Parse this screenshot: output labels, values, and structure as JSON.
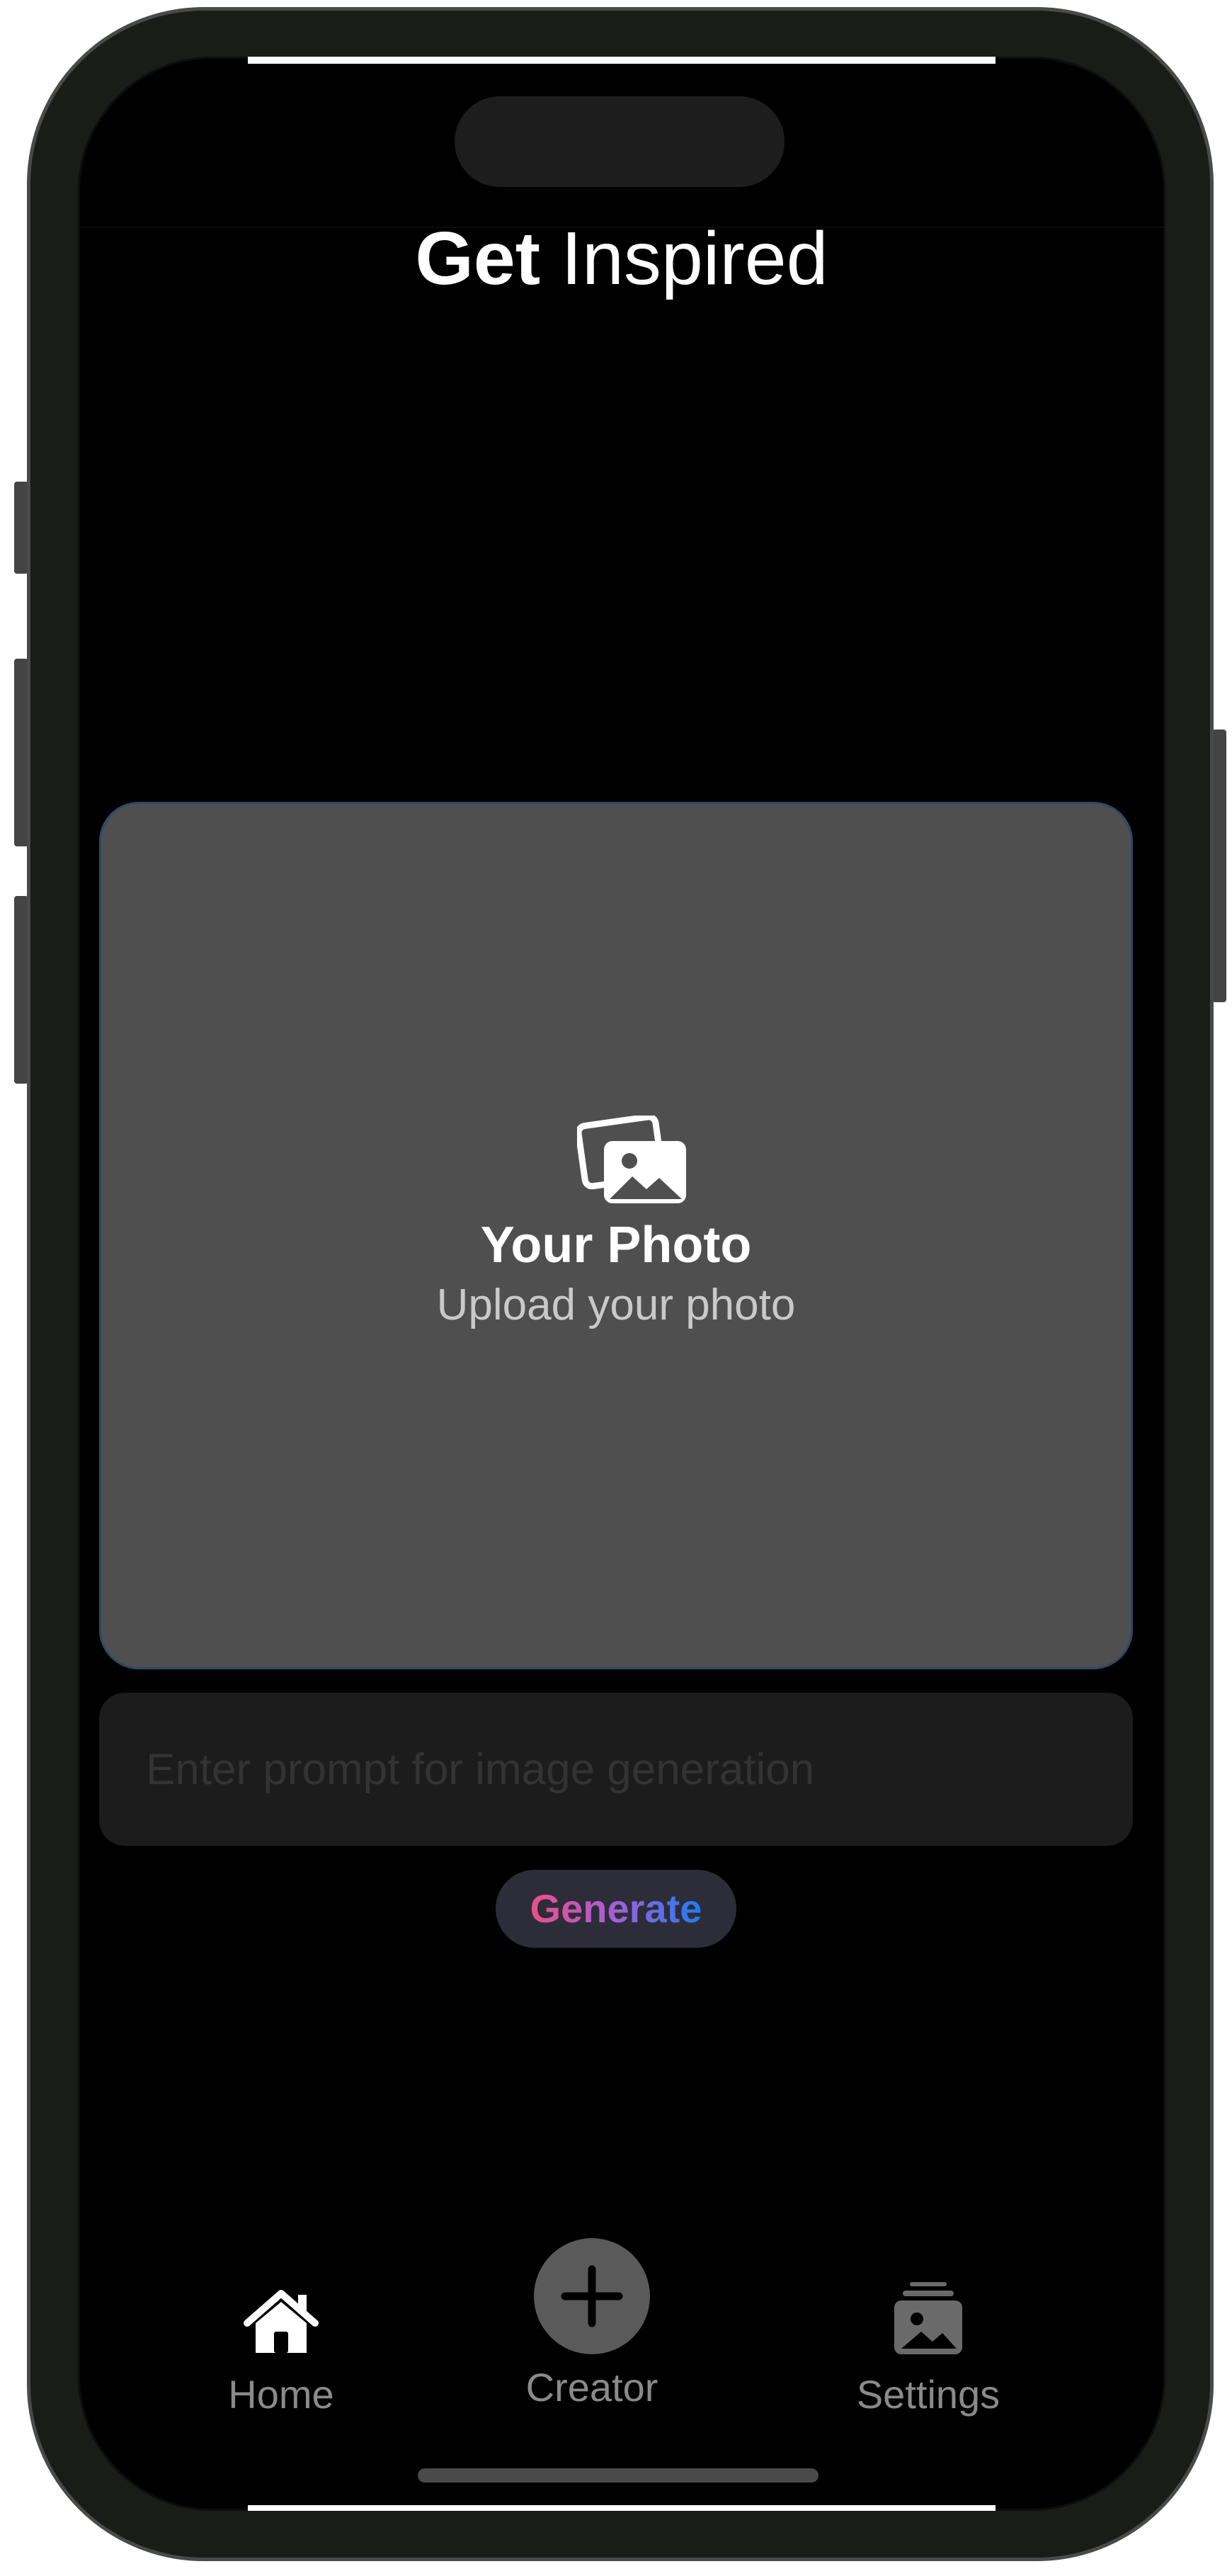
{
  "header": {
    "title_bold": "Get",
    "title_light": "Inspired"
  },
  "upload_card": {
    "icon": "photo-stack-icon",
    "title": "Your Photo",
    "subtitle": "Upload your photo"
  },
  "prompt": {
    "value": "",
    "placeholder": "Enter prompt for image generation"
  },
  "generate_button": {
    "label": "Generate"
  },
  "tabbar": {
    "items": [
      {
        "label": "Home",
        "icon": "house-icon"
      },
      {
        "label": "Creator",
        "icon": "plus-icon"
      },
      {
        "label": "Settings",
        "icon": "photo-stack-icon"
      }
    ]
  },
  "colors": {
    "background": "#000000",
    "card": "#4f4f4f",
    "input": "#1c1c1c",
    "button_bg": "#2d2d3a",
    "gradient_start": "#ec4f88",
    "gradient_end": "#1e7cf0",
    "tab_label": "#8a8a8a"
  }
}
